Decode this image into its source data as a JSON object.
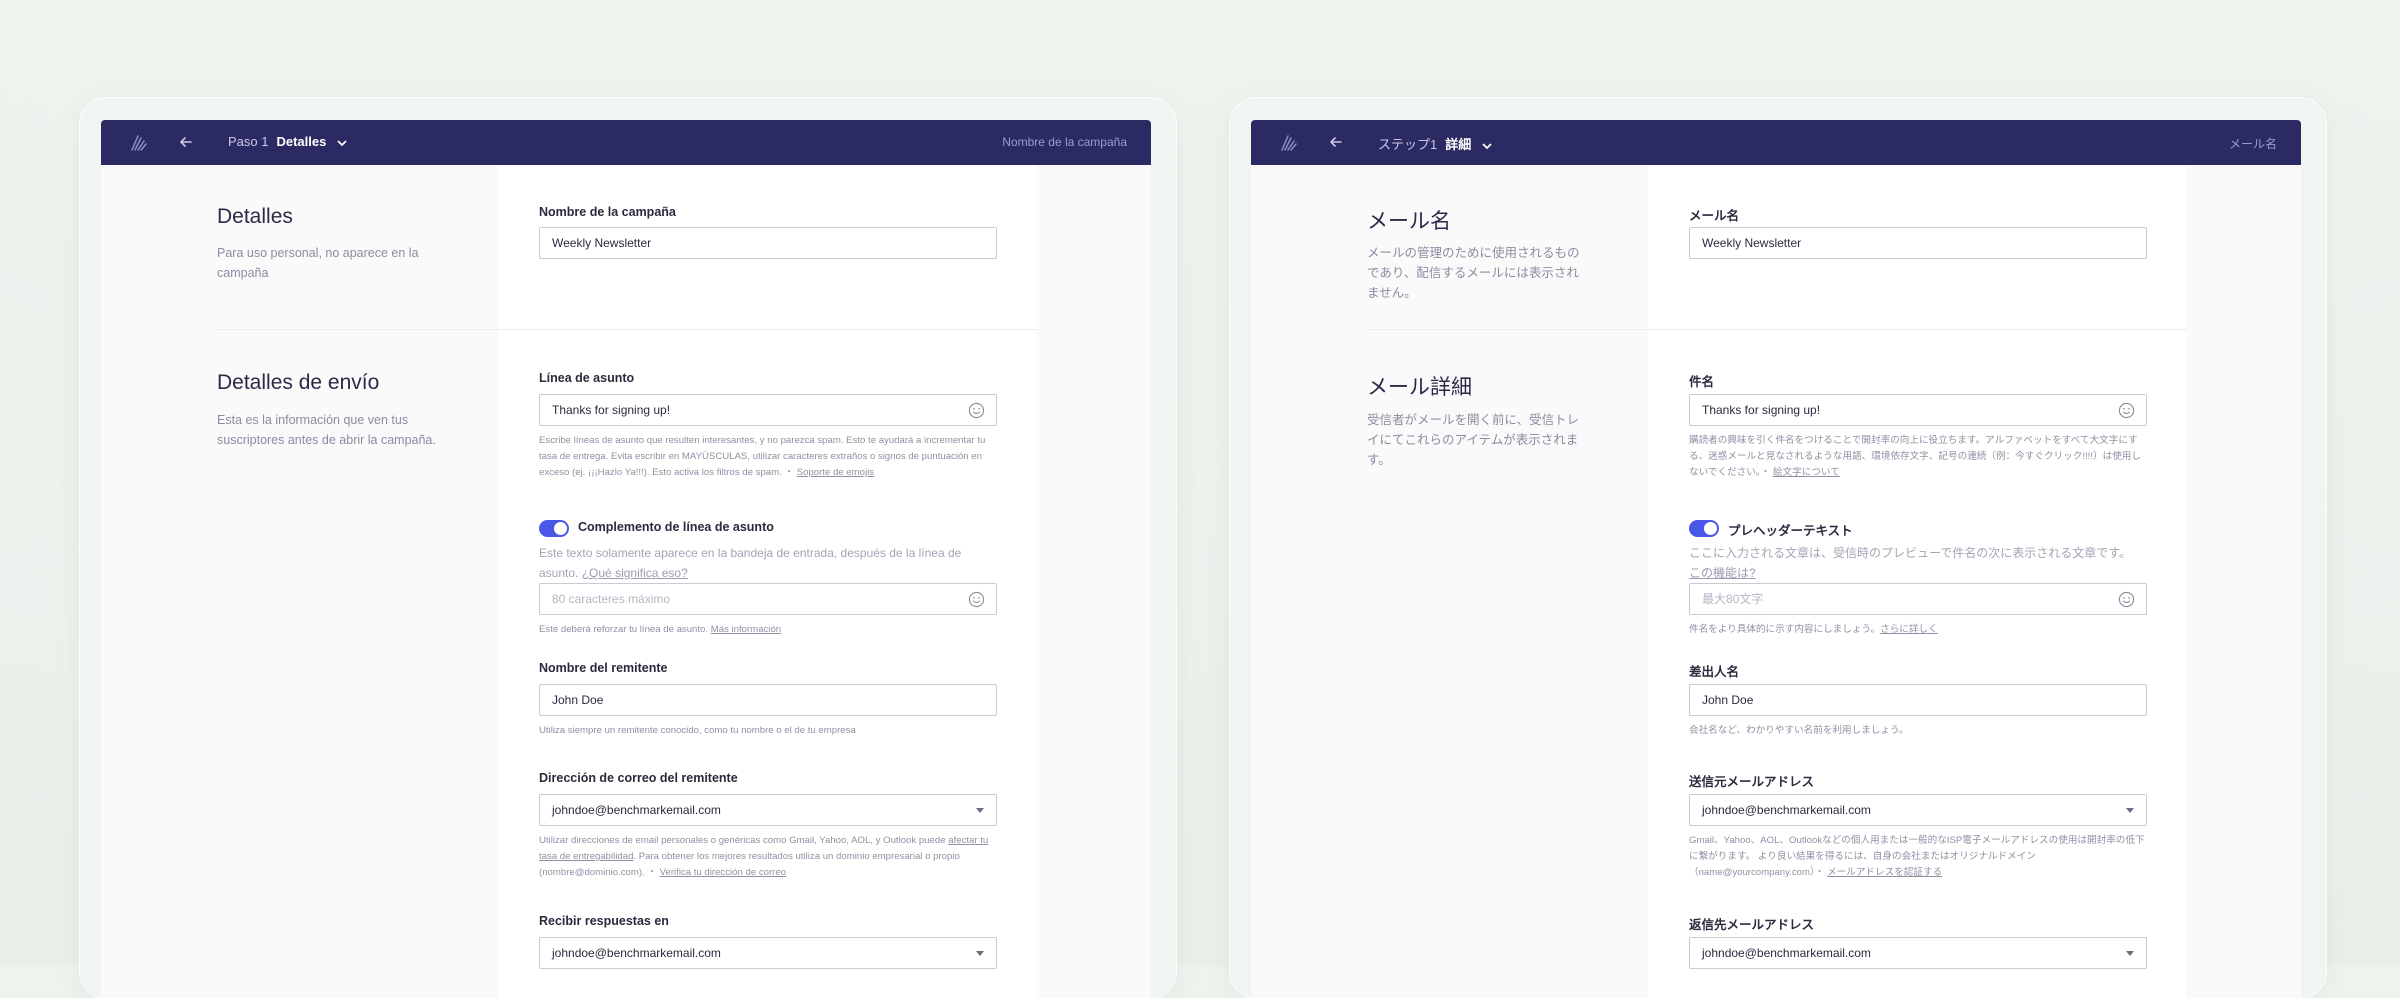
{
  "panels": [
    {
      "topbar": {
        "step": "Paso 1",
        "step_name": "Detalles",
        "campaign_name": "Nombre de la campaña"
      },
      "details": {
        "title": "Detalles",
        "desc": "Para uso personal, no aparece en la campaña",
        "campaign_label": "Nombre de la campaña",
        "campaign_value": "Weekly Newsletter"
      },
      "send": {
        "title": "Detalles de envío",
        "desc": "Esta es la información que ven tus suscriptores antes de abrir la campaña.",
        "subject_label": "Línea de asunto",
        "subject_value": "Thanks for signing up!",
        "subject_help": "Escribe líneas de asunto que resulten interesantes, y no parezca spam. Esto te ayudará a incrementar tu tasa de entrega. Evita escribir en MAYÚSCULAS, utilizar caracteres extraños o signos de puntuación en exceso (ej. ¡¡¡Hazlo Ya!!!). Esto activa los filtros de spam. ・",
        "subject_help_link": "Soporte de emojis",
        "preheader_label": "Complemento de línea de asunto",
        "preheader_note": "Este texto solamente aparece en la bandeja de entrada, después de la línea de asunto.",
        "preheader_note_link": "¿Qué significa eso?",
        "preheader_placeholder": "80 caracteres máximo",
        "preheader_help": "Este deberá reforzar tu línea de asunto.",
        "preheader_help_link": "Más información",
        "sender_label": "Nombre del remitente",
        "sender_value": "John Doe",
        "sender_help": "Utiliza siempre un remitente conocido, como tu nombre o el de tu empresa",
        "from_label": "Dirección de correo del remitente",
        "from_value": "johndoe@benchmarkemail.com",
        "from_help": "Utilizar direcciones de email personales o genéricas como Gmail, Yahoo, AOL, y Outlook puede ",
        "from_help_link1": "afectar tu tasa de entregabilidad",
        "from_help_mid": ". Para obtener los mejores resultados utiliza un dominio empresarial o propio (nombre@dominio.com). ・",
        "from_help_link2": "Verifica tu dirección de correo",
        "reply_label": "Recibir respuestas en",
        "reply_value": "johndoe@benchmarkemail.com"
      }
    },
    {
      "topbar": {
        "step": "ステップ1",
        "step_name": "詳細",
        "campaign_name": "メール名"
      },
      "details": {
        "title": "メール名",
        "desc": "メールの管理のために使用されるものであり、配信するメールには表示されません。",
        "campaign_label": "メール名",
        "campaign_value": "Weekly Newsletter"
      },
      "send": {
        "title": "メール詳細",
        "desc": "受信者がメールを開く前に、受信トレイにてこれらのアイテムが表示されます。",
        "subject_label": "件名",
        "subject_value": "Thanks for signing up!",
        "subject_help": "購読者の興味を引く件名をつけることで開封率の向上に役立ちます。アルファベットをすべて大文字にする、迷惑メールと見なされるような用語、環境依存文字、記号の連続（例：今すぐクリック!!!!）は使用しないでください。・",
        "subject_help_link": "絵文字について",
        "preheader_label": "プレヘッダーテキスト",
        "preheader_note": "ここに入力される文章は、受信時のプレビューで件名の次に表示される文章です。",
        "preheader_note_link": "この機能は?",
        "preheader_placeholder": "最大80文字",
        "preheader_help": "件名をより具体的に示す内容にしましょう。",
        "preheader_help_link": "さらに詳しく",
        "sender_label": "差出人名",
        "sender_value": "John Doe",
        "sender_help": "会社名など、わかりやすい名前を利用しましょう。",
        "from_label": "送信元メールアドレス",
        "from_value": "johndoe@benchmarkemail.com",
        "from_help": "Gmail、Yahoo、AOL、Outlookなどの個人用または一般的なISP電子メールアドレスの使用は開封率の低下に繋がります。 より良い結果を得るには、自身の会社またはオリジナルドメイン（name@yourcompany.com）・",
        "from_help_link1": "",
        "from_help_mid": "",
        "from_help_link2": "メールアドレスを認証する",
        "reply_label": "返信先メールアドレス",
        "reply_value": "johndoe@benchmarkemail.com"
      }
    }
  ]
}
